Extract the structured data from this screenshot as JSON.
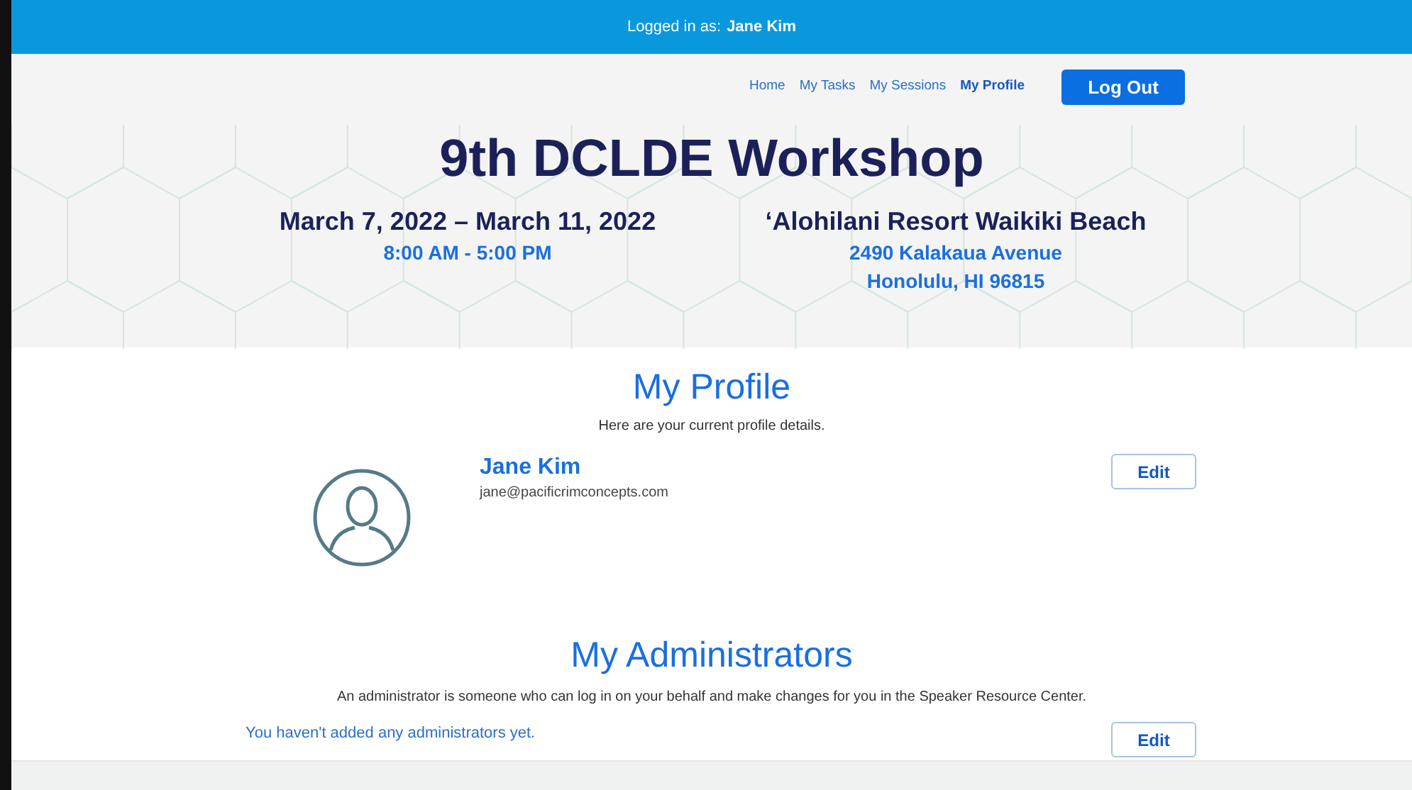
{
  "top_bar": {
    "label": "Logged in as:",
    "user": "Jane Kim"
  },
  "nav": [
    {
      "label": "Home",
      "selected": false
    },
    {
      "label": "My Tasks",
      "selected": false
    },
    {
      "label": "My Sessions",
      "selected": false
    },
    {
      "label": "My Profile",
      "selected": true
    }
  ],
  "logout_button": "Log Out",
  "event": {
    "title": "9th DCLDE Workshop",
    "dates": "March 7, 2022 – March 11, 2022",
    "hours": "8:00 AM - 5:00 PM",
    "venue": "‘Alohilani Resort Waikiki Beach",
    "address": [
      "2490 Kalakaua Avenue",
      "Honolulu, HI 96815"
    ]
  },
  "profile": {
    "heading": "My Profile",
    "intro": "Here are your current profile details.",
    "name": "Jane Kim",
    "email": "jane@pacificrimconcepts.com",
    "edit_button": "Edit"
  },
  "administrators": {
    "heading": "My Administrators",
    "intro": "An administrator is someone who can log in on your behalf and make changes for you in the Speaker Resource Center.",
    "empty_message": "You haven't added any administrators yet.",
    "edit_button": "Edit"
  }
}
